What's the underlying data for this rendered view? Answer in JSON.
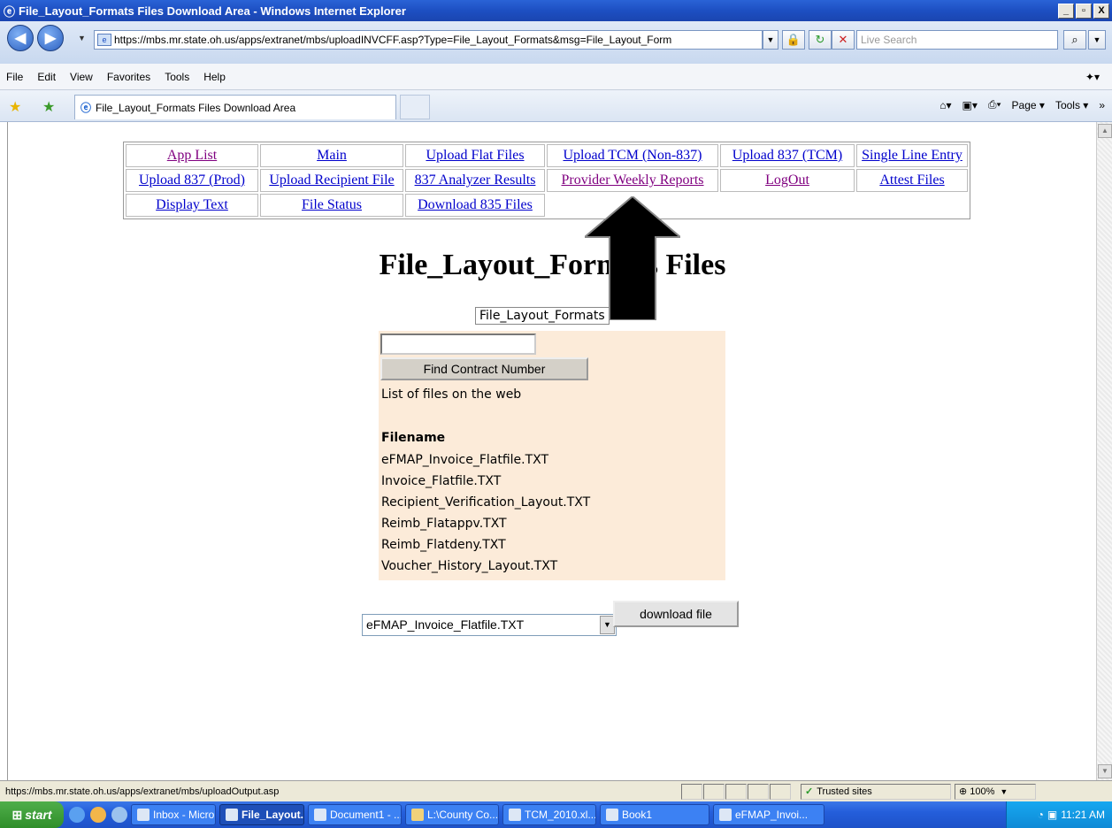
{
  "window": {
    "title": "File_Layout_Formats Files Download Area - Windows Internet Explorer",
    "buttons": {
      "minimize": "_",
      "maximize": "▫",
      "close": "X"
    }
  },
  "addressbar": {
    "url": "https://mbs.mr.state.oh.us/apps/extranet/mbs/uploadINVCFF.asp?Type=File_Layout_Formats&msg=File_Layout_Form",
    "search_placeholder": "Live Search"
  },
  "menubar": {
    "items": [
      "File",
      "Edit",
      "View",
      "Favorites",
      "Tools",
      "Help"
    ]
  },
  "tab": {
    "title": "File_Layout_Formats Files Download Area"
  },
  "commandbar": {
    "page_label": "Page",
    "tools_label": "Tools"
  },
  "nav": {
    "rows": [
      [
        "App List",
        "Main",
        "Upload Flat Files",
        "Upload TCM (Non-837)",
        "Upload 837 (TCM)",
        "Single Line Entry"
      ],
      [
        "Upload 837 (Prod)",
        "Upload Recipient File",
        "837 Analyzer Results",
        "Provider Weekly Reports",
        "LogOut",
        "Attest Files"
      ],
      [
        "Display Text",
        "File Status",
        "Download 835 Files"
      ]
    ]
  },
  "page": {
    "heading": "File_Layout_Formats Files",
    "area_label": "File_Layout_Formats",
    "contract_input_value": "",
    "find_button": "Find Contract Number",
    "list_caption": "List of files on the web",
    "filename_header": "Filename",
    "files": [
      "eFMAP_Invoice_Flatfile.TXT",
      "Invoice_Flatfile.TXT",
      "Recipient_Verification_Layout.TXT",
      "Reimb_Flatappv.TXT",
      "Reimb_Flatdeny.TXT",
      "Voucher_History_Layout.TXT"
    ],
    "selected_file": "eFMAP_Invoice_Flatfile.TXT",
    "download_button": "download file"
  },
  "statusbar": {
    "url": "https://mbs.mr.state.oh.us/apps/extranet/mbs/uploadOutput.asp",
    "zone": "Trusted sites",
    "zoom": "100%"
  },
  "taskbar": {
    "start": "start",
    "tasks": [
      {
        "label": "Inbox - Micro...",
        "active": false
      },
      {
        "label": "File_Layout...",
        "active": true
      },
      {
        "label": "Document1 - ...",
        "active": false
      },
      {
        "label": "L:\\County Co...",
        "active": false
      },
      {
        "label": "TCM_2010.xl...",
        "active": false
      },
      {
        "label": "Book1",
        "active": false
      },
      {
        "label": "eFMAP_Invoi...",
        "active": false
      }
    ],
    "clock": "11:21 AM"
  },
  "colors": {
    "link": "#0000cc",
    "visited_link": "#800080",
    "panel_bg": "#fcebd9",
    "titlebar": "#1d4fc2",
    "taskbar": "#245edb"
  }
}
